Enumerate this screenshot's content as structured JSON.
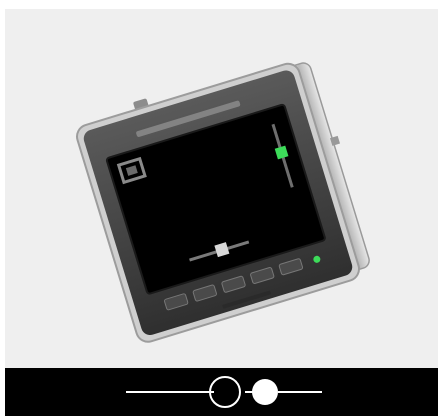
{
  "viewer": {
    "photo_subject": "digital-back-unit",
    "controls": {
      "compare_outline_state": "inactive",
      "compare_filled_state": "active"
    }
  },
  "colors": {
    "photo_background": "#efefef",
    "bottom_bar": "#000000",
    "control_color": "#ffffff",
    "indicator_green": "#3ddc5a"
  }
}
